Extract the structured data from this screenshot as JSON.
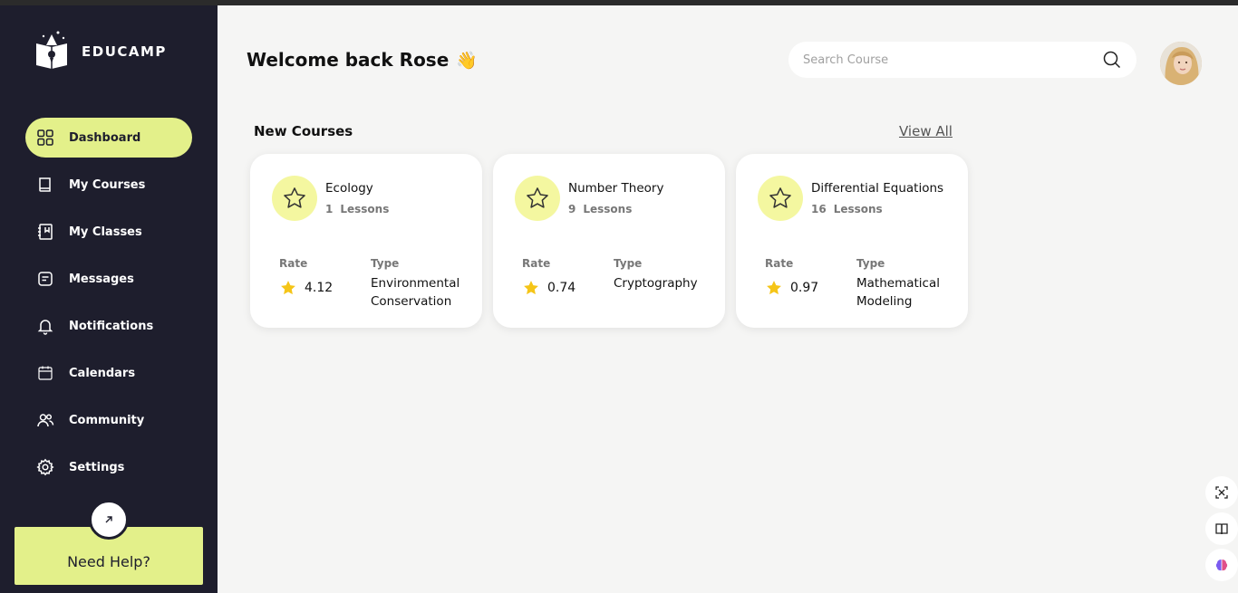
{
  "brand": {
    "name": "EDUCAMP"
  },
  "sidebar": {
    "items": [
      {
        "label": "Dashboard",
        "icon": "grid-icon",
        "active": true
      },
      {
        "label": "My Courses",
        "icon": "book-icon",
        "active": false
      },
      {
        "label": "My Classes",
        "icon": "notebook-icon",
        "active": false
      },
      {
        "label": "Messages",
        "icon": "message-icon",
        "active": false
      },
      {
        "label": "Notifications",
        "icon": "bell-icon",
        "active": false
      },
      {
        "label": "Calendars",
        "icon": "calendar-icon",
        "active": false
      },
      {
        "label": "Community",
        "icon": "users-icon",
        "active": false
      },
      {
        "label": "Settings",
        "icon": "gear-icon",
        "active": false
      }
    ],
    "help": {
      "label": "Need Help?",
      "icon": "arrow-up-right-icon"
    }
  },
  "header": {
    "welcome": "Welcome back Rose",
    "wave": "👋",
    "search": {
      "placeholder": "Search Course",
      "value": ""
    }
  },
  "courses": {
    "section_title": "New Courses",
    "view_all": "View All",
    "rate_label": "Rate",
    "type_label": "Type",
    "lessons_label": "Lessons",
    "items": [
      {
        "title": "Ecology",
        "lessons": "1",
        "rate": "4.12",
        "type": "Environmental Conservation"
      },
      {
        "title": "Number Theory",
        "lessons": "9",
        "rate": "0.74",
        "type": "Cryptography"
      },
      {
        "title": "Differential Equations",
        "lessons": "16",
        "rate": "0.97",
        "type": "Mathematical Modeling"
      }
    ]
  },
  "colors": {
    "sidebar_bg": "#1e1e2d",
    "accent": "#e3f08a",
    "card_icon_bg": "#f4f7a0",
    "star": "#f5c518",
    "page_bg": "#f5f5f4"
  }
}
